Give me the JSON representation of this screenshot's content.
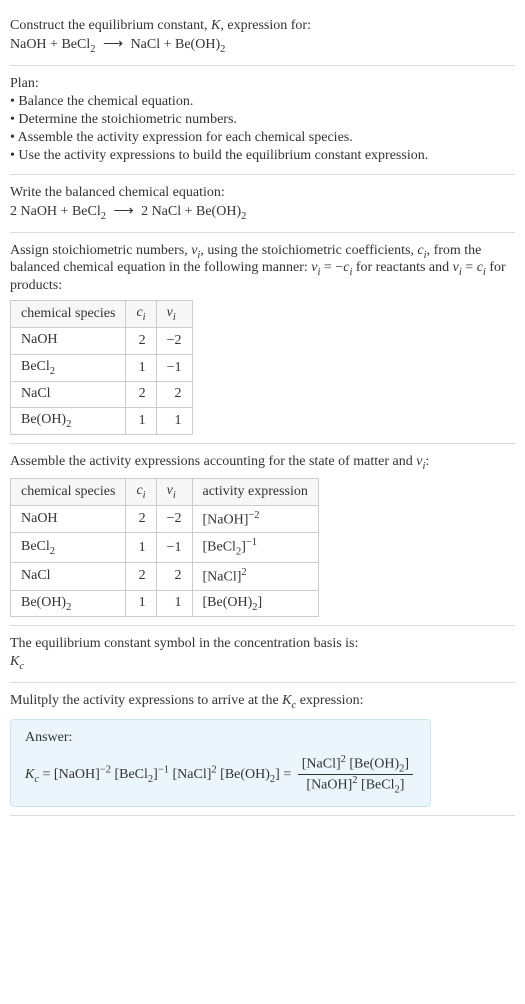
{
  "intro": {
    "line1_pre": "Construct the equilibrium constant, ",
    "K": "K",
    "line1_post": ", expression for:",
    "eq_lhs1": "NaOH + BeCl",
    "eq_lhs1_sub": "2",
    "eq_arrow": "⟶",
    "eq_rhs1": "NaCl + Be(OH)",
    "eq_rhs1_sub": "2"
  },
  "plan": {
    "title": "Plan:",
    "b1": "• Balance the chemical equation.",
    "b2": "• Determine the stoichiometric numbers.",
    "b3": "• Assemble the activity expression for each chemical species.",
    "b4": "• Use the activity expressions to build the equilibrium constant expression."
  },
  "balanced": {
    "title": "Write the balanced chemical equation:",
    "lhs": "2 NaOH + BeCl",
    "lhs_sub": "2",
    "arrow": "⟶",
    "rhs": "2 NaCl + Be(OH)",
    "rhs_sub": "2"
  },
  "stoich": {
    "p1a": "Assign stoichiometric numbers, ",
    "nu": "ν",
    "i": "i",
    "p1b": ", using the stoichiometric coefficients, ",
    "c": "c",
    "p1c": ", from the balanced chemical equation in the following manner: ",
    "eq1a": "ν",
    "eq1b": " = −",
    "eq1c": "c",
    "p1d": " for reactants and ",
    "eq2a": "ν",
    "eq2b": " = ",
    "eq2c": "c",
    "p1e": " for products:",
    "headers": {
      "h1": "chemical species",
      "h2c": "c",
      "h2i": "i",
      "h3n": "ν",
      "h3i": "i"
    },
    "rows": [
      {
        "sp": "NaOH",
        "sub": "",
        "c": "2",
        "nu": "−2"
      },
      {
        "sp": "BeCl",
        "sub": "2",
        "c": "1",
        "nu": "−1"
      },
      {
        "sp": "NaCl",
        "sub": "",
        "c": "2",
        "nu": "2"
      },
      {
        "sp": "Be(OH)",
        "sub": "2",
        "c": "1",
        "nu": "1"
      }
    ]
  },
  "activity": {
    "title_a": "Assemble the activity expressions accounting for the state of matter and ",
    "nu": "ν",
    "i": "i",
    "title_b": ":",
    "headers": {
      "h1": "chemical species",
      "h2c": "c",
      "h2i": "i",
      "h3n": "ν",
      "h3i": "i",
      "h4": "activity expression"
    },
    "rows": [
      {
        "sp": "NaOH",
        "sub": "",
        "c": "2",
        "nu": "−2",
        "act_main": "[NaOH]",
        "act_sub": "",
        "act_sup": "−2"
      },
      {
        "sp": "BeCl",
        "sub": "2",
        "c": "1",
        "nu": "−1",
        "act_main": "[BeCl",
        "act_sub": "2",
        "act_close": "]",
        "act_sup": "−1"
      },
      {
        "sp": "NaCl",
        "sub": "",
        "c": "2",
        "nu": "2",
        "act_main": "[NaCl]",
        "act_sub": "",
        "act_sup": "2"
      },
      {
        "sp": "Be(OH)",
        "sub": "2",
        "c": "1",
        "nu": "1",
        "act_main": "[Be(OH)",
        "act_sub": "2",
        "act_close": "]",
        "act_sup": ""
      }
    ]
  },
  "basis": {
    "title": "The equilibrium constant symbol in the concentration basis is:",
    "Kc_K": "K",
    "Kc_c": "c"
  },
  "multiply": {
    "title_a": "Mulitply the activity expressions to arrive at the ",
    "Kc_K": "K",
    "Kc_c": "c",
    "title_b": " expression:"
  },
  "answer": {
    "label": "Answer:",
    "Kc_K": "K",
    "Kc_c": "c",
    "eq": " = ",
    "t1": "[NaOH]",
    "t1sup": "−2",
    "t2a": "[BeCl",
    "t2sub": "2",
    "t2b": "]",
    "t2sup": "−1",
    "t3": "[NaCl]",
    "t3sup": "2",
    "t4a": "[Be(OH)",
    "t4sub": "2",
    "t4b": "]",
    "eq2": " = ",
    "num1": "[NaCl]",
    "num1sup": "2",
    "num2a": "[Be(OH)",
    "num2sub": "2",
    "num2b": "]",
    "den1": "[NaOH]",
    "den1sup": "2",
    "den2a": "[BeCl",
    "den2sub": "2",
    "den2b": "]"
  },
  "chart_data": {
    "type": "table",
    "tables": [
      {
        "title": "stoichiometric numbers",
        "columns": [
          "chemical species",
          "c_i",
          "ν_i"
        ],
        "rows": [
          [
            "NaOH",
            2,
            -2
          ],
          [
            "BeCl2",
            1,
            -1
          ],
          [
            "NaCl",
            2,
            2
          ],
          [
            "Be(OH)2",
            1,
            1
          ]
        ]
      },
      {
        "title": "activity expressions",
        "columns": [
          "chemical species",
          "c_i",
          "ν_i",
          "activity expression"
        ],
        "rows": [
          [
            "NaOH",
            2,
            -2,
            "[NaOH]^-2"
          ],
          [
            "BeCl2",
            1,
            -1,
            "[BeCl2]^-1"
          ],
          [
            "NaCl",
            2,
            2,
            "[NaCl]^2"
          ],
          [
            "Be(OH)2",
            1,
            1,
            "[Be(OH)2]"
          ]
        ]
      }
    ]
  }
}
